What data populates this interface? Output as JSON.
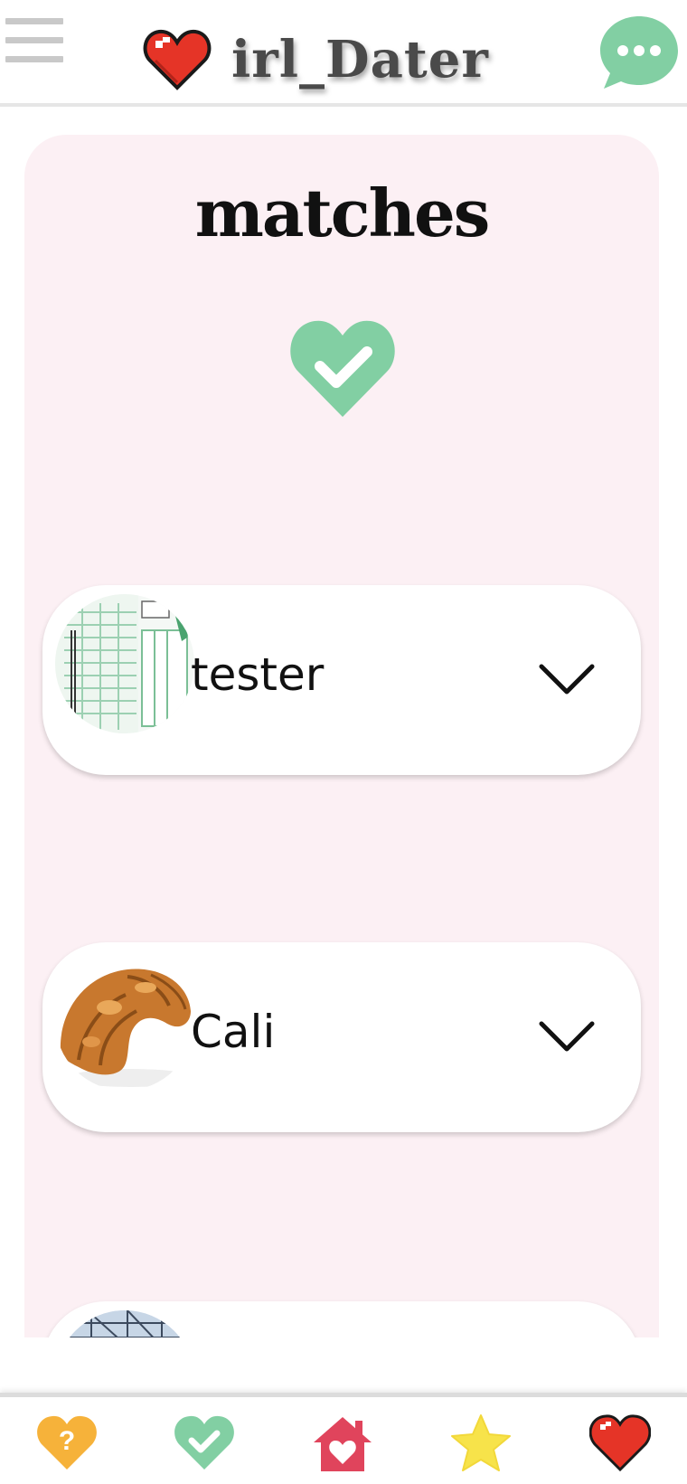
{
  "header": {
    "app_title": "irl_Dater",
    "menu_icon": "hamburger-menu-icon",
    "logo_icon": "pixel-heart-icon",
    "chat_icon": "chat-bubble-icon"
  },
  "page": {
    "title": "matches",
    "title_icon": "heart-check-icon"
  },
  "matches": [
    {
      "name": "tester",
      "avatar": "document-form-photo",
      "expand_icon": "chevron-down-icon"
    },
    {
      "name": "Cali",
      "avatar": "croissant-photo",
      "expand_icon": "chevron-down-icon"
    },
    {
      "name": "",
      "avatar": "ship-photo",
      "expand_icon": "chevron-down-icon"
    }
  ],
  "bottom_nav": [
    {
      "icon": "help-heart-icon"
    },
    {
      "icon": "matches-heart-icon"
    },
    {
      "icon": "home-icon"
    },
    {
      "icon": "star-icon"
    },
    {
      "icon": "likes-heart-icon"
    }
  ],
  "colors": {
    "accent_green": "#82cfa3",
    "panel_pink": "#fcf0f4",
    "heart_red": "#e53427",
    "home_red": "#e0445c",
    "star_yellow": "#f7e34a",
    "help_orange": "#f6b23a"
  }
}
